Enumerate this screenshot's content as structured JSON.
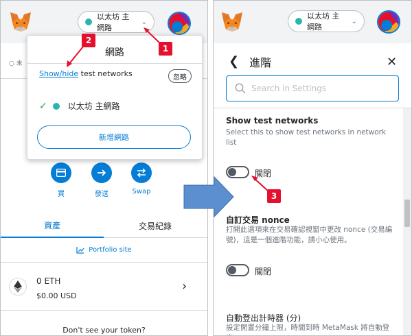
{
  "left": {
    "network_pill": "以太坊 主網路",
    "unconnected_text": "未",
    "dropdown": {
      "title": "網路",
      "show_hide_link": "Show/hide",
      "show_hide_rest": " test networks",
      "dismiss_label": "忽略",
      "selected_network": "以太坊 主網路",
      "add_network_label": "新增網路"
    },
    "actions": {
      "buy_label": "買",
      "send_label": "發送",
      "swap_label": "Swap"
    },
    "tabs": {
      "assets_label": "資產",
      "activity_label": "交易紀錄"
    },
    "portfolio_label": "Portfolio site",
    "asset": {
      "amount": "0 ETH",
      "usd": "$0.00 USD"
    },
    "token_question": "Don't see your token?"
  },
  "badges": {
    "one": "1",
    "two": "2",
    "three": "3"
  },
  "right": {
    "network_pill": "以太坊 主網路",
    "page_title": "進階",
    "search_placeholder": "Search in Settings",
    "settings": [
      {
        "title": "Show test networks",
        "desc": "Select this to show test networks in network list",
        "toggle_label": "關閉"
      },
      {
        "title": "自訂交易 nonce",
        "desc": "打開此選項來在交易確認視窗中更改 nonce (交易編號)，這是一個進階功能，請小心使用。",
        "toggle_label": "關閉"
      },
      {
        "title": "自動登出計時器 (分)",
        "desc": "設定閒置分鐘上限，時間到時 MetaMask 將自動登出。"
      }
    ]
  },
  "colors": {
    "accent": "#037dd6",
    "badge": "#e5102e",
    "arrow": "#5b8fcf",
    "network_dot": "#29b6af"
  }
}
